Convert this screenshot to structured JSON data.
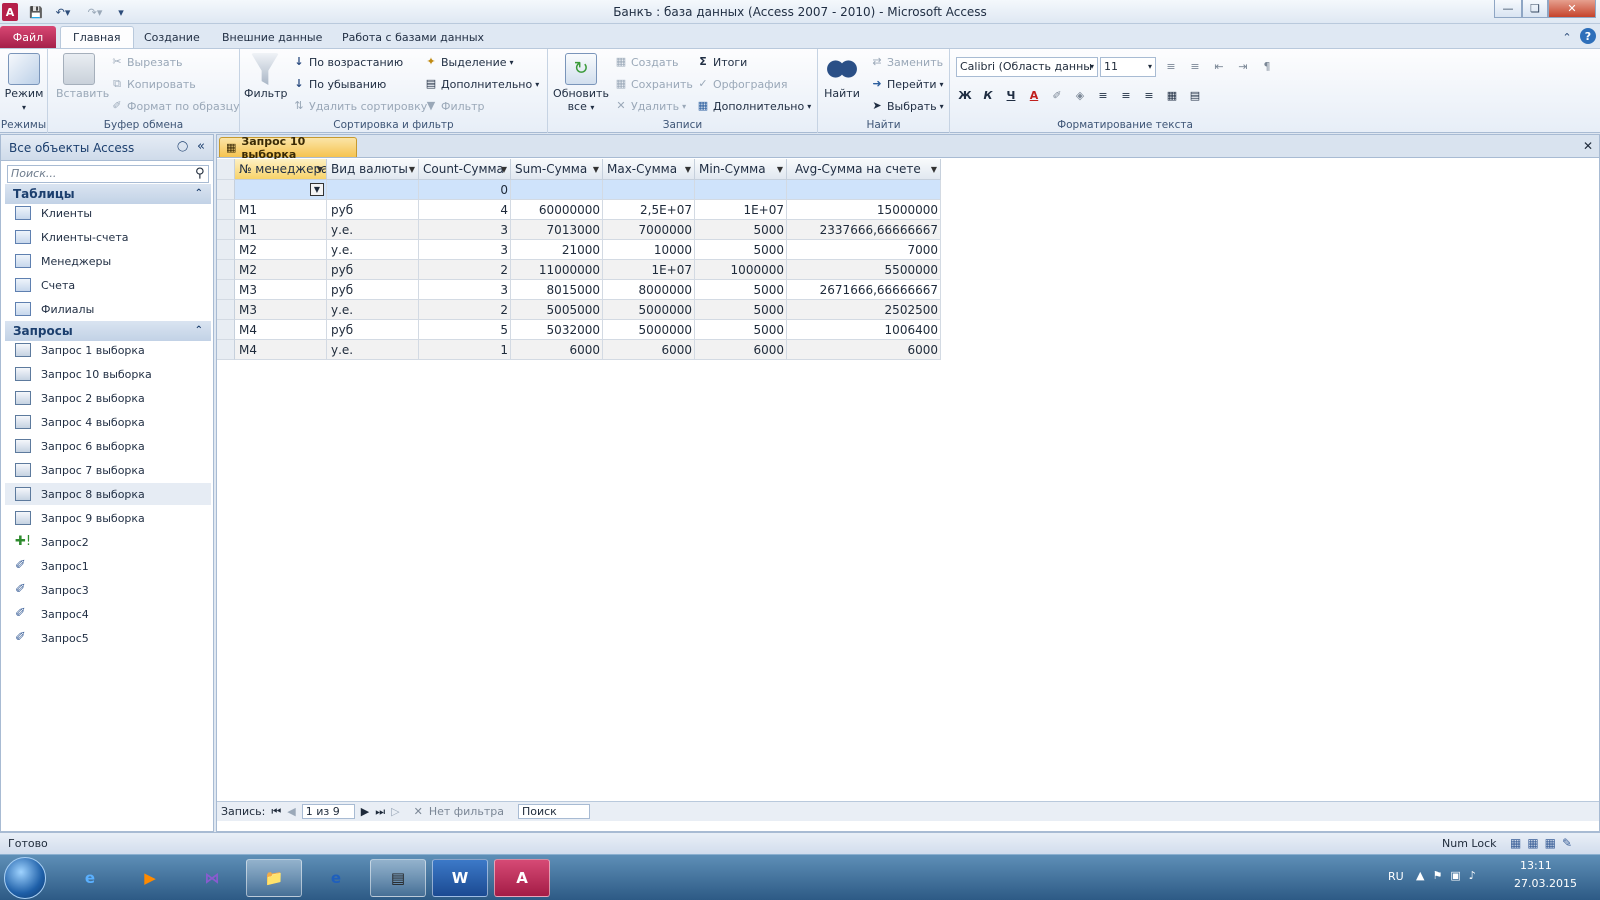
{
  "window": {
    "title": "Банкъ : база данных (Access 2007 - 2010)  -  Microsoft Access"
  },
  "tabs": [
    {
      "label": "Файл"
    },
    {
      "label": "Главная"
    },
    {
      "label": "Создание"
    },
    {
      "label": "Внешние данные"
    },
    {
      "label": "Работа с базами данных"
    }
  ],
  "ribbon": {
    "modes": {
      "view": "Режим",
      "group": "Режимы"
    },
    "clipboard": {
      "paste": "Вставить",
      "cut": "Вырезать",
      "copy": "Копировать",
      "format": "Формат по образцу",
      "group": "Буфер обмена"
    },
    "sort": {
      "filter": "Фильтр",
      "asc": "По возрастанию",
      "desc": "По убыванию",
      "remove": "Удалить сортировку",
      "selection": "Выделение",
      "advanced": "Дополнительно",
      "toggle": "Фильтр",
      "group": "Сортировка и фильтр"
    },
    "records": {
      "refresh": "Обновить",
      "refresh2": "все",
      "new": "Создать",
      "save": "Сохранить",
      "delete": "Удалить",
      "totals": "Итоги",
      "spelling": "Орфография",
      "more": "Дополнительно",
      "group": "Записи"
    },
    "find": {
      "find": "Найти",
      "replace": "Заменить",
      "goto": "Перейти",
      "select": "Выбрать",
      "group": "Найти"
    },
    "text": {
      "font": "Calibri (Область данны",
      "size": "11",
      "group": "Форматирование текста"
    }
  },
  "nav": {
    "header": "Все объекты Access",
    "search_placeholder": "Поиск...",
    "tables_label": "Таблицы",
    "tables": [
      "Клиенты",
      "Клиенты-счета",
      "Менеджеры",
      "Счета",
      "Филиалы"
    ],
    "queries_label": "Запросы",
    "queries": [
      "Запрос 1 выборка",
      "Запрос 10 выборка",
      "Запрос 2 выборка",
      "Запрос 4 выборка",
      "Запрос 6 выборка",
      "Запрос 7 выборка",
      "Запрос 8 выборка",
      "Запрос 9 выборка",
      "Запрос2",
      "Запрос1",
      "Запрос3",
      "Запрос4",
      "Запрос5"
    ]
  },
  "document": {
    "tab_label": "Запрос 10 выборка",
    "columns": [
      "№ менеджера",
      "Вид валюты",
      "Count-Сумма",
      "Sum-Сумма",
      "Max-Сумма",
      "Min-Сумма",
      "Avg-Сумма на счете"
    ],
    "total_row": [
      "",
      "",
      "0",
      "",
      "",
      "",
      ""
    ],
    "rows": [
      [
        "М1",
        "руб",
        "4",
        "60000000",
        "2,5E+07",
        "1E+07",
        "15000000"
      ],
      [
        "М1",
        "у.е.",
        "3",
        "7013000",
        "7000000",
        "5000",
        "2337666,66666667"
      ],
      [
        "М2",
        "у.е.",
        "3",
        "21000",
        "10000",
        "5000",
        "7000"
      ],
      [
        "М2",
        "руб",
        "2",
        "11000000",
        "1E+07",
        "1000000",
        "5500000"
      ],
      [
        "М3",
        "руб",
        "3",
        "8015000",
        "8000000",
        "5000",
        "2671666,66666667"
      ],
      [
        "М3",
        "у.е.",
        "2",
        "5005000",
        "5000000",
        "5000",
        "2502500"
      ],
      [
        "М4",
        "руб",
        "5",
        "5032000",
        "5000000",
        "5000",
        "1006400"
      ],
      [
        "М4",
        "у.е.",
        "1",
        "6000",
        "6000",
        "6000",
        "6000"
      ]
    ]
  },
  "record_nav": {
    "label": "Запись:",
    "position": "1 из 9",
    "filter": "Нет фильтра",
    "search": "Поиск"
  },
  "status": {
    "left": "Готово",
    "numlock": "Num Lock"
  },
  "taskbar": {
    "lang": "RU",
    "time": "13:11",
    "date": "27.03.2015"
  }
}
